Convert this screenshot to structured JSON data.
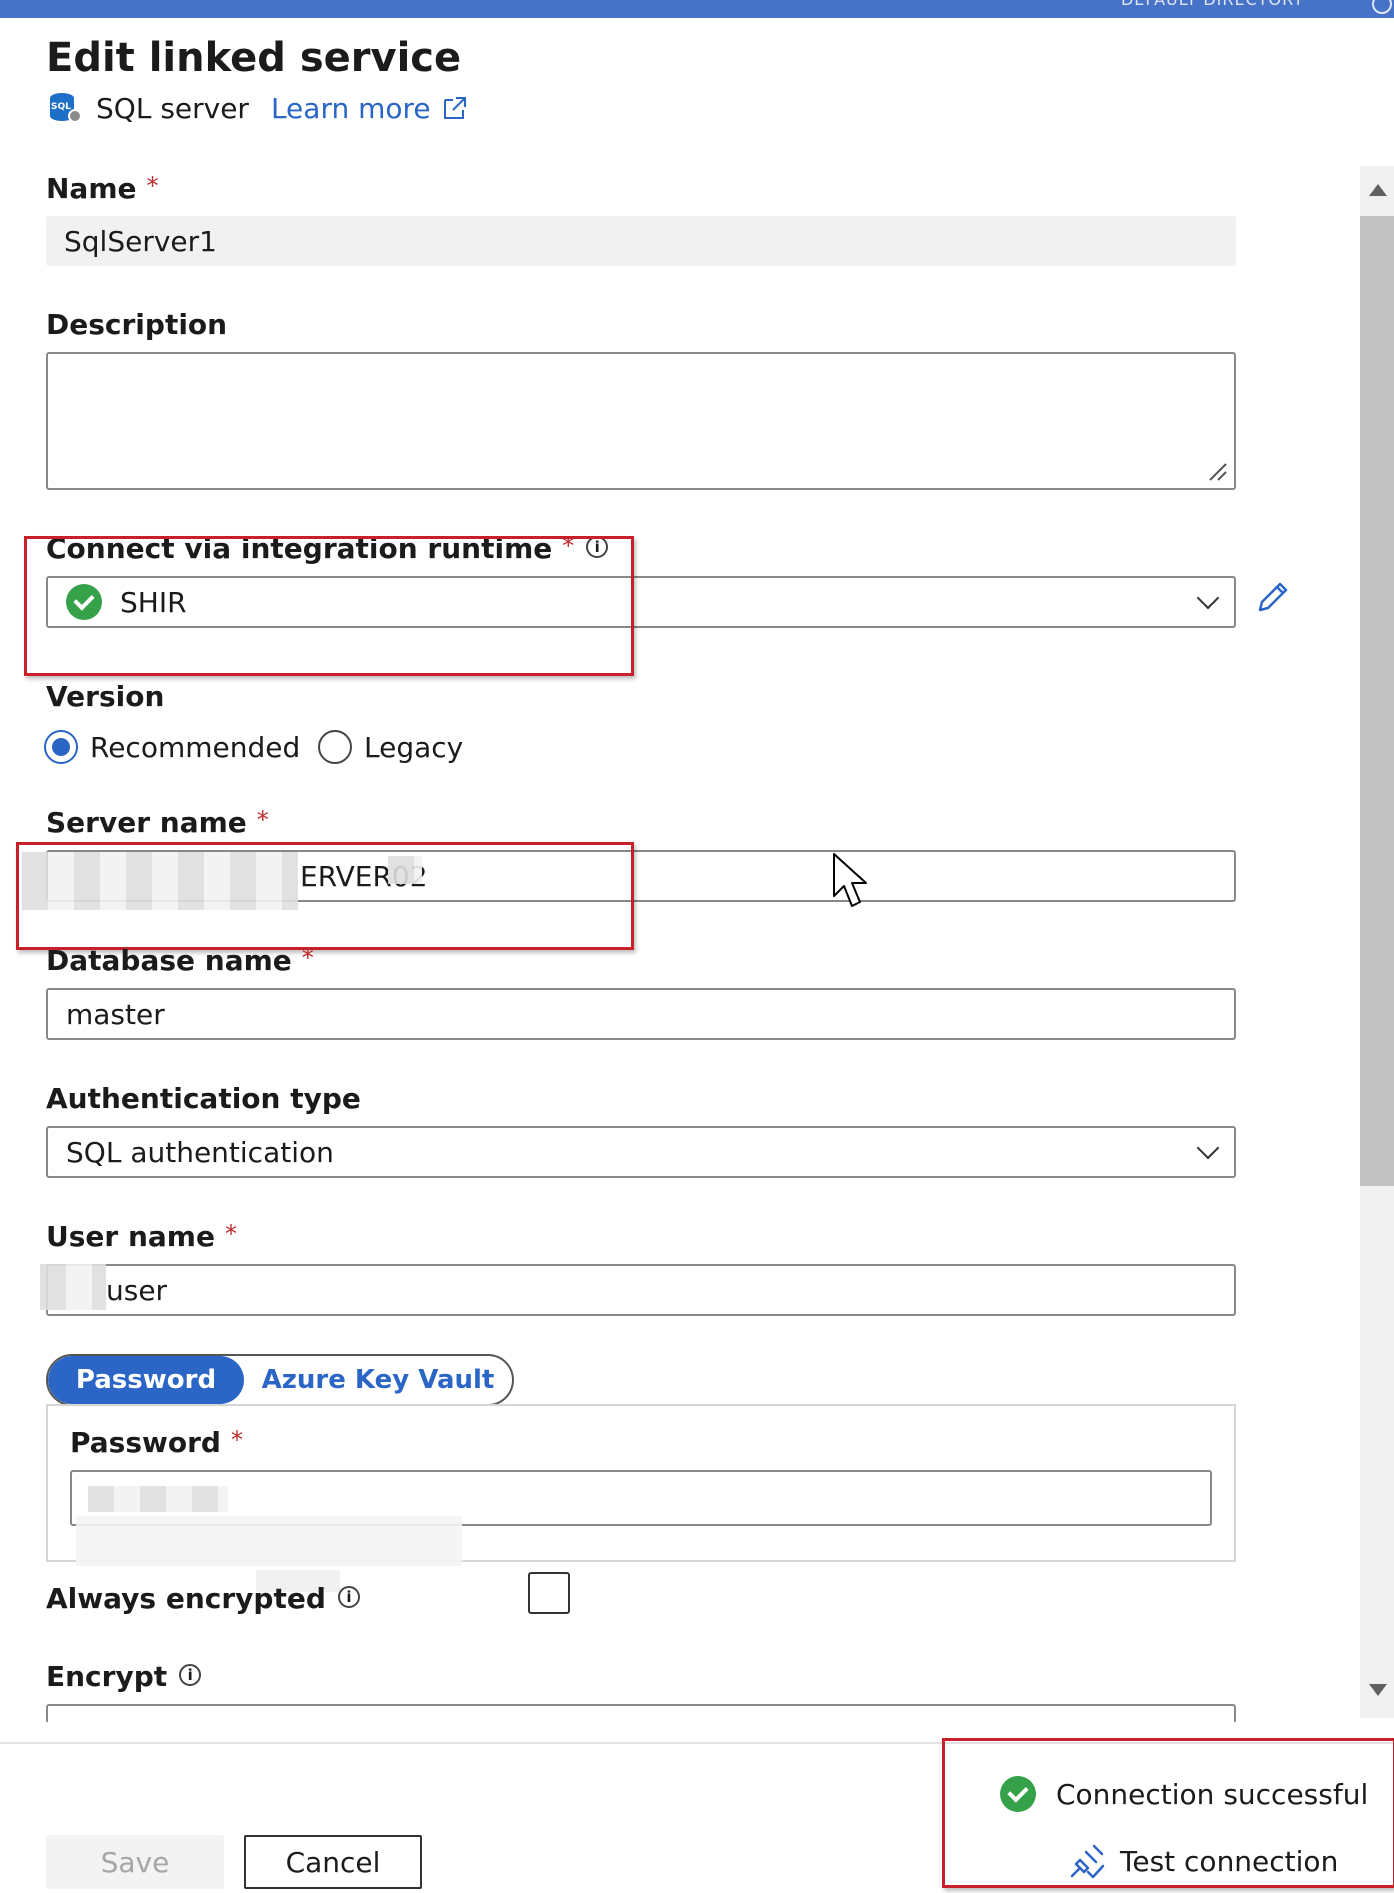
{
  "header": {
    "directory_label": "DEFAULT DIRECTORY",
    "title": "Edit linked service",
    "service_type": "SQL server",
    "learn_more": "Learn more",
    "sql_icon_text": "SQL"
  },
  "form": {
    "name": {
      "label": "Name",
      "required_mark": "*",
      "value": "SqlServer1"
    },
    "description": {
      "label": "Description",
      "value": ""
    },
    "integration_runtime": {
      "label": "Connect via integration runtime",
      "required_mark": "*",
      "info": "i",
      "value": "SHIR"
    },
    "version": {
      "label": "Version",
      "options": [
        "Recommended",
        "Legacy"
      ],
      "selected": "Recommended"
    },
    "server_name": {
      "label": "Server name",
      "required_mark": "*",
      "value": "ERVER02"
    },
    "database_name": {
      "label": "Database name",
      "required_mark": "*",
      "value": "master"
    },
    "authentication_type": {
      "label": "Authentication type",
      "value": "SQL authentication"
    },
    "user_name": {
      "label": "User name",
      "required_mark": "*",
      "value": "user"
    },
    "credential_tabs": {
      "active": "Password",
      "inactive": "Azure Key Vault"
    },
    "password": {
      "label": "Password",
      "required_mark": "*",
      "value": ""
    },
    "always_encrypted": {
      "label": "Always encrypted",
      "info": "i",
      "checked": false
    },
    "encrypt": {
      "label": "Encrypt",
      "info": "i"
    }
  },
  "footer": {
    "save_label": "Save",
    "cancel_label": "Cancel",
    "status_text": "Connection successful",
    "test_connection_label": "Test connection"
  },
  "colors": {
    "accent": "#2b66c7",
    "success": "#35a24a",
    "required": "#c12a2a",
    "highlight_box": "#c8202a",
    "topbar": "#4673c8"
  },
  "icons": [
    "sql-server-icon",
    "external-link-icon",
    "info-icon",
    "check-circle-icon",
    "chevron-down-icon",
    "pencil-icon",
    "plug-icon",
    "cursor-icon"
  ]
}
